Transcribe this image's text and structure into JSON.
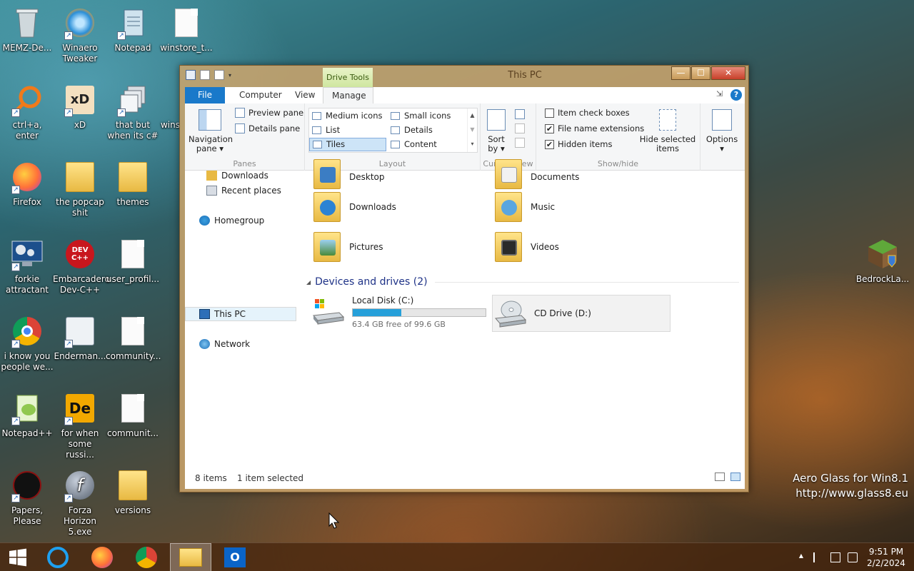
{
  "desktop": {
    "icons": [
      {
        "label": "MEMZ-De..."
      },
      {
        "label": "Winaero Tweaker"
      },
      {
        "label": "Notepad"
      },
      {
        "label": "winstore_t..."
      },
      {
        "label": "ctrl+a, enter"
      },
      {
        "label": "xD"
      },
      {
        "label": "that but when its c#"
      },
      {
        "label": "wins"
      },
      {
        "label": "Firefox"
      },
      {
        "label": "the popcap shit"
      },
      {
        "label": "themes"
      },
      {
        "label": "forkie attractant"
      },
      {
        "label": "Embarcadero Dev-C++"
      },
      {
        "label": "user_profil..."
      },
      {
        "label": "i know you people we..."
      },
      {
        "label": "Enderman..."
      },
      {
        "label": "community..."
      },
      {
        "label": "Notepad++"
      },
      {
        "label": "for when some russi..."
      },
      {
        "label": "communit..."
      },
      {
        "label": "Papers, Please"
      },
      {
        "label": "Forza Horizon 5.exe"
      },
      {
        "label": "versions"
      },
      {
        "label": "BedrockLa..."
      }
    ],
    "xd_glyph": "xD",
    "dev_glyph": "DEV C++",
    "de_glyph": "De",
    "flash_glyph": "f"
  },
  "window": {
    "title": "This PC",
    "context_tab": "Drive Tools",
    "controls": {
      "minimize": "—",
      "maximize": "☐",
      "close": "✕"
    },
    "tabs": {
      "file": "File",
      "computer": "Computer",
      "view": "View",
      "manage": "Manage"
    },
    "help": "?",
    "ribbon": {
      "panes": {
        "label": "Panes",
        "navigation_pane_line1": "Navigation",
        "navigation_pane_line2": "pane ▾",
        "preview_pane": "Preview pane",
        "details_pane": "Details pane"
      },
      "layout": {
        "label": "Layout",
        "items": [
          "Medium icons",
          "Small icons",
          "List",
          "Details",
          "Tiles",
          "Content"
        ],
        "selected": "Tiles",
        "scroll_up": "▲",
        "scroll_down": "▼",
        "scroll_more": "▾"
      },
      "current_view": {
        "label": "Current view",
        "sort_line1": "Sort",
        "sort_line2": "by ▾"
      },
      "show_hide": {
        "label": "Show/hide",
        "item_check_boxes": "Item check boxes",
        "file_name_extensions": "File name extensions",
        "hidden_items": "Hidden items",
        "item_check_boxes_checked": false,
        "file_name_extensions_checked": true,
        "hidden_items_checked": true,
        "check_mark": "✔",
        "hide_selected_line1": "Hide selected",
        "hide_selected_line2": "items"
      },
      "options": {
        "line1": "Options",
        "line2": "▾"
      }
    },
    "nav": {
      "downloads": "Downloads",
      "recent_places": "Recent places",
      "homegroup": "Homegroup",
      "this_pc": "This PC",
      "network": "Network"
    },
    "folders": [
      "Desktop",
      "Documents",
      "Downloads",
      "Music",
      "Pictures",
      "Videos"
    ],
    "devices_section": {
      "title": "Devices and drives (2)",
      "collapse": "◢"
    },
    "drives": [
      {
        "name": "Local Disk (C:)",
        "free_text": "63.4 GB free of 99.6 GB",
        "used_fraction": 0.364
      },
      {
        "name": "CD Drive (D:)"
      }
    ],
    "status": {
      "items": "8 items",
      "selected": "1 item selected"
    }
  },
  "watermark": {
    "line1": "Aero Glass for Win8.1",
    "line2": "http://www.glass8.eu"
  },
  "taskbar": {
    "tray_expand": "▲",
    "clock_time": "9:51 PM",
    "clock_date": "2/2/2024",
    "outlook_glyph": "O"
  },
  "colors": {
    "accent": "#1979ca",
    "drive_bar": "#26a0da",
    "section_title": "#1e3287"
  }
}
